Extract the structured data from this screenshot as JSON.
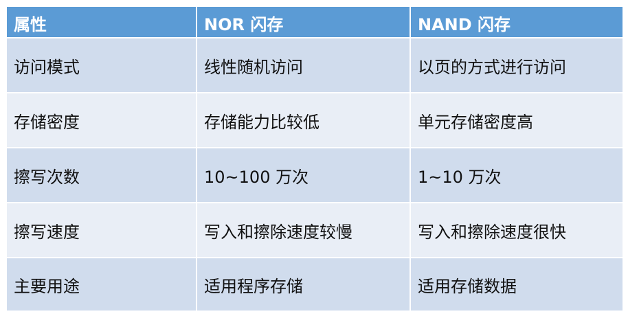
{
  "table": {
    "headers": [
      "属性",
      "NOR 闪存",
      "NAND 闪存"
    ],
    "rows": [
      [
        "访问模式",
        "线性随机访问",
        "以页的方式进行访问"
      ],
      [
        "存储密度",
        "存储能力比较低",
        "单元存储密度高"
      ],
      [
        "擦写次数",
        "10~100 万次",
        "1~10 万次"
      ],
      [
        "擦写速度",
        "写入和擦除速度较慢",
        "写入和擦除速度很快"
      ],
      [
        "主要用途",
        "适用程序存储",
        "适用存储数据"
      ]
    ]
  },
  "colors": {
    "header_bg": "#5b9bd5",
    "row_dark": "#d0dced",
    "row_light": "#e9eef6",
    "header_text": "#ffffff"
  }
}
